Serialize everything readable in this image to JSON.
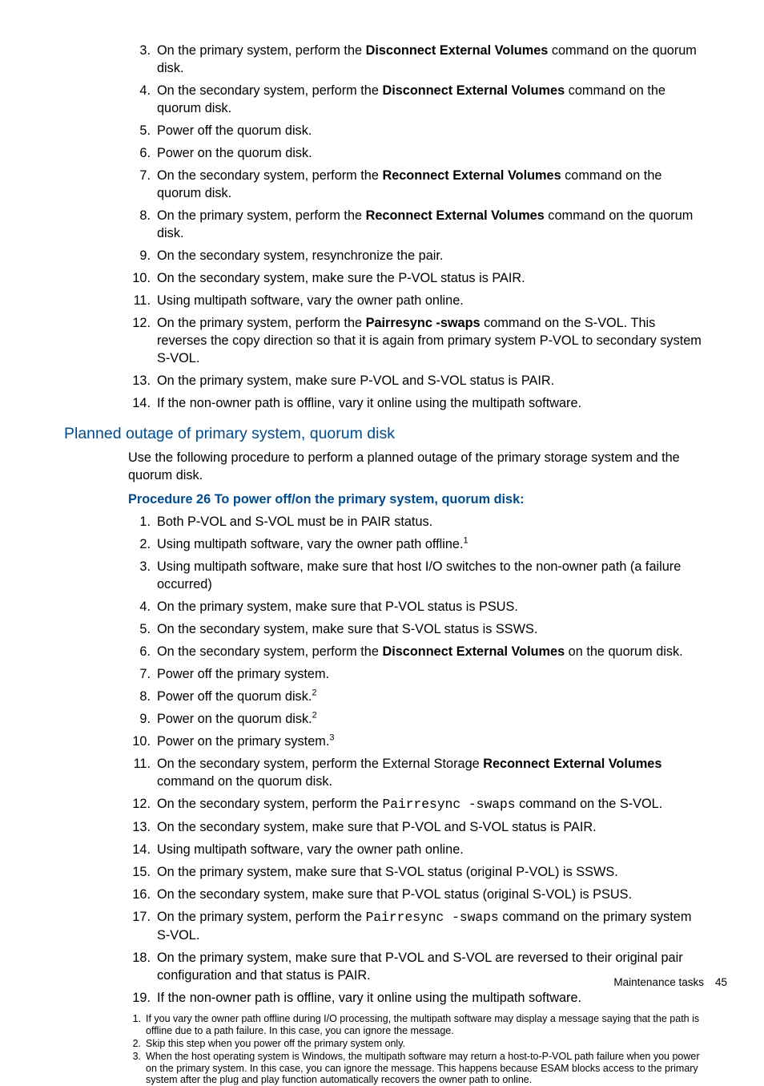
{
  "list1": {
    "start": 3,
    "items": [
      {
        "pre": "On the primary system, perform the ",
        "bold": "Disconnect External Volumes",
        "post": " command on the quorum disk."
      },
      {
        "pre": "On the secondary system, perform the ",
        "bold": "Disconnect External Volumes",
        "post": " command on the quorum disk."
      },
      {
        "pre": "Power off the quorum disk.",
        "bold": "",
        "post": ""
      },
      {
        "pre": "Power on the quorum disk.",
        "bold": "",
        "post": ""
      },
      {
        "pre": "On the secondary system, perform the ",
        "bold": "Reconnect External Volumes",
        "post": " command on the quorum disk."
      },
      {
        "pre": "On the primary system, perform the ",
        "bold": "Reconnect External Volumes",
        "post": " command on the quorum disk."
      },
      {
        "pre": "On the secondary system, resynchronize the pair.",
        "bold": "",
        "post": ""
      },
      {
        "pre": "On the secondary system, make sure the P-VOL status is PAIR.",
        "bold": "",
        "post": ""
      },
      {
        "pre": "Using multipath software, vary the owner path online.",
        "bold": "",
        "post": ""
      },
      {
        "pre": "On the primary system, perform the ",
        "bold": "Pairresync -swaps",
        "post": " command on the S-VOL. This reverses the copy direction so that it is again from primary system P-VOL to secondary system S-VOL."
      },
      {
        "pre": "On the primary system, make sure P-VOL and S-VOL status is PAIR.",
        "bold": "",
        "post": ""
      },
      {
        "pre": "If the non-owner path is offline, vary it online using the multipath software.",
        "bold": "",
        "post": ""
      }
    ]
  },
  "section_heading": "Planned outage of primary system, quorum disk",
  "intro": "Use the following procedure to perform a planned outage of the primary storage system and the quorum disk.",
  "proc_title": "Procedure 26 To power off/on the primary system, quorum disk:",
  "list2": {
    "start": 1,
    "items": [
      {
        "pre": "Both P-VOL and S-VOL must be in PAIR status.",
        "bold": "",
        "post": "",
        "mono": "",
        "post2": "",
        "fn": ""
      },
      {
        "pre": "Using multipath software, vary the owner path offline.",
        "bold": "",
        "post": "",
        "mono": "",
        "post2": "",
        "fn": "1"
      },
      {
        "pre": "Using multipath software, make sure that host I/O switches to the non-owner path (a failure occurred)",
        "bold": "",
        "post": "",
        "mono": "",
        "post2": "",
        "fn": ""
      },
      {
        "pre": "On the primary system, make sure that P-VOL status is PSUS.",
        "bold": "",
        "post": "",
        "mono": "",
        "post2": "",
        "fn": ""
      },
      {
        "pre": "On the secondary system, make sure that S-VOL status is SSWS.",
        "bold": "",
        "post": "",
        "mono": "",
        "post2": "",
        "fn": ""
      },
      {
        "pre": "On the secondary system, perform the ",
        "bold": "Disconnect External Volumes",
        "post": " on the quorum disk.",
        "mono": "",
        "post2": "",
        "fn": ""
      },
      {
        "pre": "Power off the primary system.",
        "bold": "",
        "post": "",
        "mono": "",
        "post2": "",
        "fn": ""
      },
      {
        "pre": "Power off the quorum disk.",
        "bold": "",
        "post": "",
        "mono": "",
        "post2": "",
        "fn": "2"
      },
      {
        "pre": "Power on the quorum disk.",
        "bold": "",
        "post": "",
        "mono": "",
        "post2": "",
        "fn": "2"
      },
      {
        "pre": "Power on the primary system.",
        "bold": "",
        "post": "",
        "mono": "",
        "post2": "",
        "fn": "3"
      },
      {
        "pre": "On the secondary system, perform the External Storage ",
        "bold": "Reconnect External Volumes",
        "post": " command on the quorum disk.",
        "mono": "",
        "post2": "",
        "fn": ""
      },
      {
        "pre": "On the secondary system, perform the ",
        "bold": "",
        "post": "",
        "mono": "Pairresync -swaps",
        "post2": " command on the S-VOL.",
        "fn": ""
      },
      {
        "pre": "On the secondary system, make sure that P-VOL and S-VOL status is PAIR.",
        "bold": "",
        "post": "",
        "mono": "",
        "post2": "",
        "fn": ""
      },
      {
        "pre": "Using multipath software, vary the owner path online.",
        "bold": "",
        "post": "",
        "mono": "",
        "post2": "",
        "fn": ""
      },
      {
        "pre": "On the primary system, make sure that S-VOL status (original P-VOL) is SSWS.",
        "bold": "",
        "post": "",
        "mono": "",
        "post2": "",
        "fn": ""
      },
      {
        "pre": "On the secondary system, make sure that P-VOL status (original S-VOL) is PSUS.",
        "bold": "",
        "post": "",
        "mono": "",
        "post2": "",
        "fn": ""
      },
      {
        "pre": "On the primary system, perform the ",
        "bold": "",
        "post": "",
        "mono": "Pairresync -swaps",
        "post2": " command on the primary system S-VOL.",
        "fn": ""
      },
      {
        "pre": "On the primary system, make sure that P-VOL and S-VOL are reversed to their original pair configuration and that status is PAIR.",
        "bold": "",
        "post": "",
        "mono": "",
        "post2": "",
        "fn": ""
      },
      {
        "pre": "If the non-owner path is offline, vary it online using the multipath software.",
        "bold": "",
        "post": "",
        "mono": "",
        "post2": "",
        "fn": ""
      }
    ]
  },
  "footnotes": [
    "If you vary the owner path offline during I/O processing, the multipath software may display a message saying that the path is offline due to a path failure. In this case, you can ignore the message.",
    "Skip this step when you power off the primary system only.",
    "When the host operating system is Windows, the multipath software may return a host-to-P-VOL path failure when you power on the primary system. In this case, you can ignore the message. This happens because ESAM blocks access to the primary system after the plug and play function automatically recovers the owner path to online."
  ],
  "footer": {
    "label": "Maintenance tasks",
    "page": "45"
  }
}
